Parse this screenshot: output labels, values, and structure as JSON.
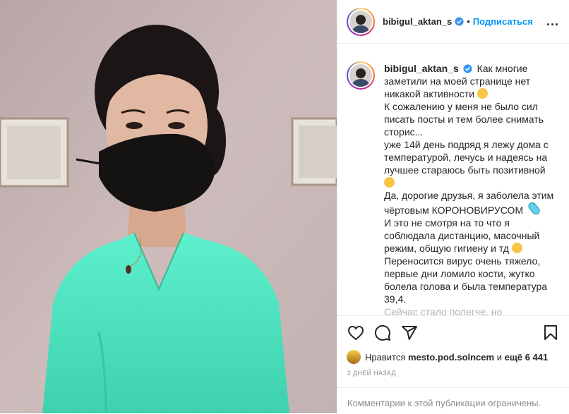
{
  "header": {
    "username": "bibigul_aktan_s",
    "separator": "•",
    "follow_label": "Подписаться",
    "more_label": "..."
  },
  "caption": {
    "username": "bibigul_aktan_s",
    "lines": [
      "Как многие",
      "заметили на моей странице нет",
      "никакой активности",
      "К сожалению у меня не было сил",
      "писать посты и тем более снимать",
      "сторис...",
      "уже 14й день подряд я лежу дома с",
      "температурой, лечусь и надеясь на",
      "лучшее стараюсь быть позитивной",
      "",
      "Да, дорогие друзья, я заболела этим",
      "чёртовым КОРОНОВИРУСОМ",
      "И это не смотря на то что я",
      "соблюдала дистанцию, масочный",
      "режим, общую гигиену и тд",
      "Переносится вирус очень тяжело,",
      "первые дни ломило кости, жутко",
      "болела голова и была температура",
      "39,4.",
      "Сейчас стало полегче, но"
    ]
  },
  "likes": {
    "prefix": "Нравится",
    "liker": "mesto.pod.solncem",
    "middle": "и",
    "rest": "ещё 6 441"
  },
  "timestamp": "2 ДНЕЙ НАЗАД",
  "comments_notice": "Комментарии к этой публикации ограничены.",
  "icons": [
    "heart-icon",
    "comment-icon",
    "share-icon",
    "bookmark-icon",
    "verified-icon"
  ],
  "colors": {
    "link": "#0095f6",
    "muted": "#8e8e8e",
    "blouse": "#4fe3bf"
  }
}
